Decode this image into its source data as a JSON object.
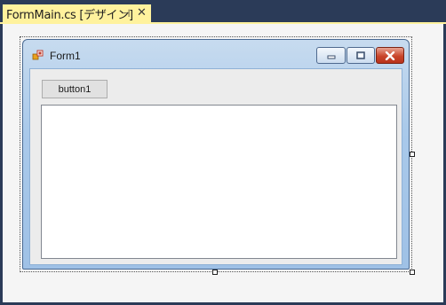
{
  "document_tab": {
    "title": "FormMain.cs [デザイン]",
    "pin_icon": "pin-icon",
    "close_icon": "close-icon"
  },
  "form": {
    "title": "Form1",
    "icon": "form-icon",
    "controls": [
      "minimize-icon",
      "maximize-icon",
      "close-icon"
    ],
    "button1_label": "button1",
    "textbox_value": ""
  },
  "colors": {
    "tab_accent": "#fff29d",
    "ide_background": "#2b3b58",
    "close_button": "#c9452b"
  }
}
